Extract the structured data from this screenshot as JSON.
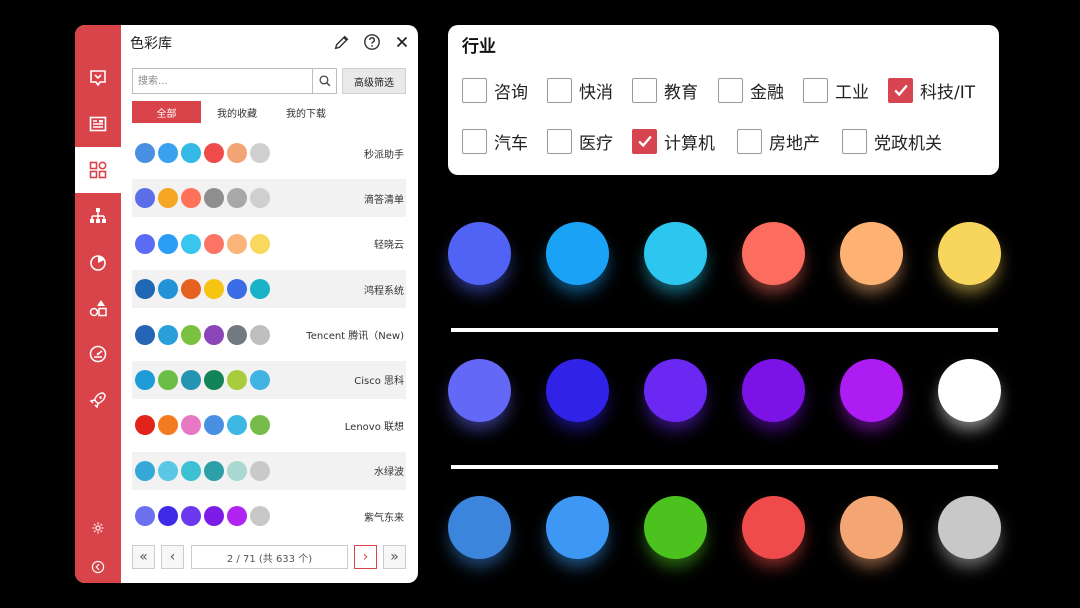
{
  "panel": {
    "title": "色彩库",
    "search_placeholder": "搜索...",
    "advanced_filter": "高级筛选",
    "tabs": [
      "全部",
      "我的收藏",
      "我的下载"
    ],
    "schemes": [
      {
        "name": "秒派助手",
        "colors": [
          "#4a90e2",
          "#3aa0f0",
          "#35b9e6",
          "#ef4b4b",
          "#f2a474",
          "#cfcfcf"
        ]
      },
      {
        "name": "滴答清单",
        "colors": [
          "#5b6ee8",
          "#f5a623",
          "#ff7257",
          "#8e8e8e",
          "#a8a8a8",
          "#cfcfcf"
        ]
      },
      {
        "name": "轻晓云",
        "colors": [
          "#5b6bf3",
          "#2a9ef5",
          "#38c6ee",
          "#fb7466",
          "#fbb47a",
          "#f9d85e"
        ]
      },
      {
        "name": "鸿程系统",
        "colors": [
          "#1f66b4",
          "#2393d8",
          "#e6611f",
          "#f6c512",
          "#3a6ce6",
          "#19b3c8"
        ]
      },
      {
        "name": "Tencent 腾讯（New)",
        "colors": [
          "#2664b5",
          "#2aa0da",
          "#7ac13f",
          "#8b45b7",
          "#727a80",
          "#bfbfbf"
        ]
      },
      {
        "name": "Cisco 思科",
        "colors": [
          "#1f9bd7",
          "#6bbe45",
          "#2593b2",
          "#13845a",
          "#a9cc3f",
          "#41b3e2"
        ]
      },
      {
        "name": "Lenovo 联想",
        "colors": [
          "#e2231a",
          "#f27a20",
          "#e878c4",
          "#4a90e2",
          "#3db7e4",
          "#76bc4a"
        ]
      },
      {
        "name": "水绿波",
        "colors": [
          "#35a8d8",
          "#5bc6e6",
          "#3bc1d3",
          "#2d9fa6",
          "#a8d8d0",
          "#c9c9c9"
        ]
      },
      {
        "name": "紫气东来",
        "colors": [
          "#6a70ee",
          "#3d2be8",
          "#6b38f0",
          "#7d1ce6",
          "#b023f2",
          "#c8c8c8"
        ]
      }
    ],
    "pager": {
      "first": "«",
      "prev": "‹",
      "info": "2 / 71 (共 633 个)",
      "next": "›",
      "last": "»"
    }
  },
  "industry": {
    "title": "行业",
    "options": [
      {
        "label": "咨询",
        "checked": false
      },
      {
        "label": "快消",
        "checked": false
      },
      {
        "label": "教育",
        "checked": false
      },
      {
        "label": "金融",
        "checked": false
      },
      {
        "label": "工业",
        "checked": false
      },
      {
        "label": "科技/IT",
        "checked": true
      },
      {
        "label": "汽车",
        "checked": false
      },
      {
        "label": "医疗",
        "checked": false
      },
      {
        "label": "计算机",
        "checked": true
      },
      {
        "label": "房地产",
        "checked": false
      },
      {
        "label": "党政机关",
        "checked": false
      }
    ]
  },
  "palette_rows": [
    [
      "#5163f4",
      "#1aa2f7",
      "#2cc6ee",
      "#fc6c5f",
      "#fdb173",
      "#f8d55d"
    ],
    [
      "#6468f7",
      "#3022e6",
      "#6a28f2",
      "#7c13e6",
      "#ae1cf4",
      "#ffffff"
    ],
    [
      "#3b86dc",
      "#3c98f4",
      "#4cc21f",
      "#f04b4b",
      "#f3a574",
      "#c8c8c8"
    ]
  ],
  "accent": "#d9444b"
}
